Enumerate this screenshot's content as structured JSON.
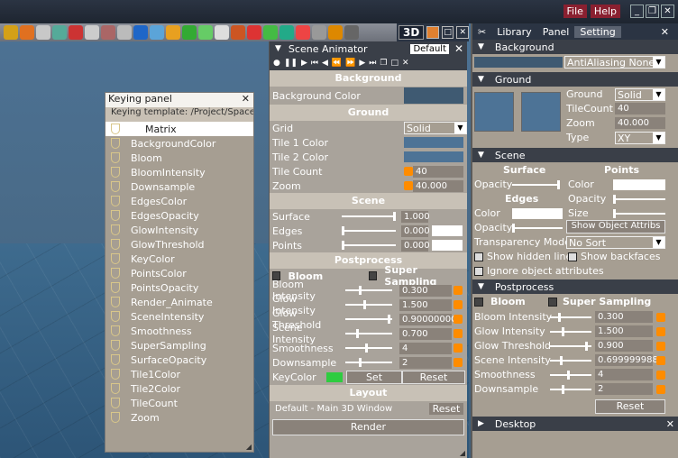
{
  "menu": {
    "file": "File",
    "help": "Help"
  },
  "keying": {
    "title": "Keying panel",
    "template": "Keying template: /Project/SpaceM",
    "selected": "Matrix",
    "items": [
      "BackgroundColor",
      "Bloom",
      "BloomIntensity",
      "Downsample",
      "EdgesColor",
      "EdgesOpacity",
      "GlowIntensity",
      "GlowThreshold",
      "KeyColor",
      "PointsColor",
      "PointsOpacity",
      "Render_Animate",
      "SceneIntensity",
      "Smoothness",
      "SuperSampling",
      "SurfaceOpacity",
      "Tile1Color",
      "Tile2Color",
      "TileCount",
      "Zoom"
    ]
  },
  "view": {
    "label": "3D"
  },
  "anim": {
    "title": "Scene Animator",
    "default": "Default",
    "sec_background": "Background",
    "background_color": "Background Color",
    "sec_ground": "Ground",
    "grid": "Grid",
    "grid_val": "Solid",
    "tile1": "Tile 1 Color",
    "tile2": "Tile 2 Color",
    "tile_count": "Tile Count",
    "tile_count_val": "40",
    "zoom": "Zoom",
    "zoom_val": "40.000",
    "sec_scene": "Scene",
    "surface": "Surface",
    "surface_val": "1.000",
    "edges": "Edges",
    "edges_val": "0.000",
    "points": "Points",
    "points_val": "0.000",
    "sec_post": "Postprocess",
    "bloom": "Bloom",
    "super": "Super Sampling",
    "bloom_int": "Bloom Intensity",
    "bloom_int_val": "0.300",
    "glow_int": "Glow Intensity",
    "glow_int_val": "1.500",
    "glow_thr": "Glow Threshold",
    "glow_thr_val": "0.9000000C",
    "scene_int": "Scene Intensity",
    "scene_int_val": "0.700",
    "smooth": "Smoothness",
    "smooth_val": "4",
    "down": "Downsample",
    "down_val": "2",
    "key_color": "KeyColor",
    "set": "Set",
    "reset": "Reset",
    "sec_layout": "Layout",
    "layout_val": "Default - Main 3D Window",
    "layout_reset": "Reset",
    "render": "Render"
  },
  "right": {
    "tabs": [
      "Library",
      "Panel",
      "Setting"
    ],
    "background": "Background",
    "aa": "AntiAliasing None",
    "ground": "Ground",
    "g_ground": "Ground",
    "g_ground_val": "Solid",
    "g_tc": "TileCount",
    "g_tc_val": "40",
    "g_zoom": "Zoom",
    "g_zoom_val": "40.000",
    "g_type": "Type",
    "g_type_val": "XY",
    "scene": "Scene",
    "surface": "Surface",
    "points": "Points",
    "opacity": "Opacity",
    "color": "Color",
    "edges": "Edges",
    "size": "Size",
    "show_obj": "Show Object Attribs",
    "tmode": "Transparency Mode",
    "tmode_val": "No Sort",
    "hidden": "Show hidden lines",
    "backfaces": "Show backfaces",
    "ignore": "Ignore object attributes",
    "post": "Postprocess",
    "bloom": "Bloom",
    "super": "Super Sampling",
    "bloom_int": "Bloom Intensity",
    "bloom_int_val": "0.300",
    "glow_int": "Glow Intensity",
    "glow_int_val": "1.500",
    "glow_thr": "Glow Threshold",
    "glow_thr_val": "0.900",
    "scene_int": "Scene Intensity",
    "scene_int_val": "0.699999988",
    "smooth": "Smoothness",
    "smooth_val": "4",
    "down": "Downsample",
    "down_val": "2",
    "reset": "Reset",
    "desktop": "Desktop"
  },
  "colors": {
    "key_color": "#2ecc40",
    "bg_color": "#3f5a72"
  }
}
